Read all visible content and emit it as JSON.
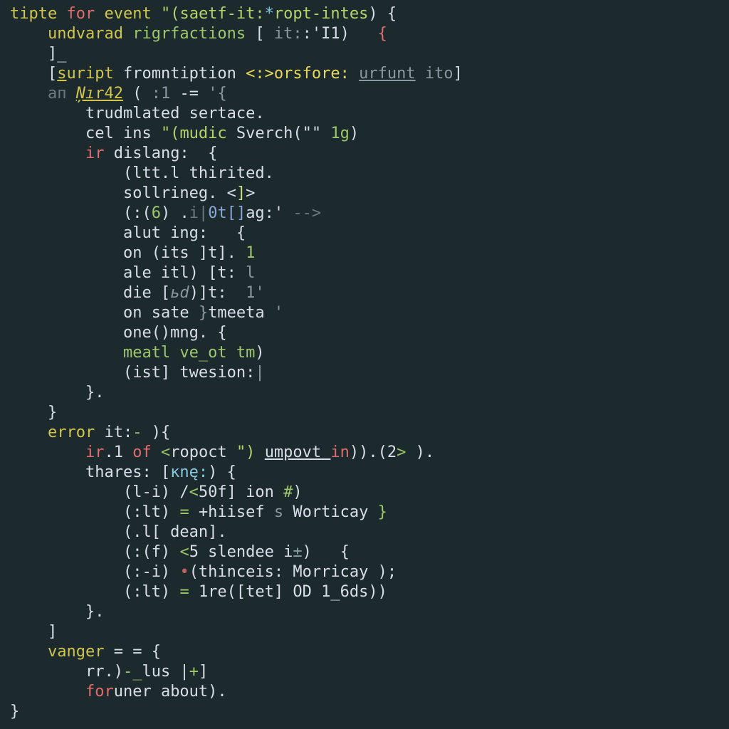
{
  "colors": {
    "background": "#1c2a2e",
    "default": "#d8dee8",
    "yellow": "#d0c54a",
    "yellow_bright": "#e8d85a",
    "string_green": "#b6d26a",
    "green": "#9ec66a",
    "red": "#e06c6c",
    "red_muted": "#c06060",
    "grey": "#8a99a0",
    "grey_dim": "#6e7a80",
    "cyan": "#88c8e0",
    "blue": "#88a8d8",
    "lime": "#c8e082"
  },
  "lines": [
    {
      "indent": 0,
      "tokens": [
        {
          "t": "tipte ",
          "c": "c-yel"
        },
        {
          "t": "for ",
          "c": "c-red"
        },
        {
          "t": "event ",
          "c": "c-yel"
        },
        {
          "t": "\"(",
          "c": "c-str"
        },
        {
          "t": "saetf-іt:",
          "c": "c-str"
        },
        {
          "t": "*",
          "c": "c-cyn"
        },
        {
          "t": "ropt-intes",
          "c": "c-str"
        },
        {
          "t": ") {",
          "c": "c-wht"
        }
      ]
    },
    {
      "indent": 1,
      "tokens": [
        {
          "t": "undvarad ",
          "c": "c-yel"
        },
        {
          "t": "rigrfactions ",
          "c": "c-grn"
        },
        {
          "t": "[ ",
          "c": "c-wht"
        },
        {
          "t": "it:",
          "c": "c-gry"
        },
        {
          "t": ":'I1",
          "c": "c-wht"
        },
        {
          "t": ")",
          "c": "c-wht"
        },
        {
          "t": "   {",
          "c": "c-red"
        }
      ]
    },
    {
      "indent": 1,
      "tokens": [
        {
          "t": "]",
          "c": "c-wht"
        },
        {
          "t": "_",
          "c": "c-wht caret-holder"
        }
      ]
    },
    {
      "indent": 1,
      "tokens": [
        {
          "t": "[",
          "c": "c-wht"
        },
        {
          "t": "s",
          "c": "c-yel u"
        },
        {
          "t": "uript ",
          "c": "c-yel"
        },
        {
          "t": "fromntiption ",
          "c": "c-wht"
        },
        {
          "t": "<:>",
          "c": "c-yelbr"
        },
        {
          "t": "orsfore: ",
          "c": "c-yelbr"
        },
        {
          "t": "urfunt",
          "c": "c-gry u"
        },
        {
          "t": " ito",
          "c": "c-gry"
        },
        {
          "t": "]",
          "c": "c-wht"
        }
      ]
    },
    {
      "indent": 1,
      "tokens": [
        {
          "t": "aп ",
          "c": "c-grydim"
        },
        {
          "t": "Ņı",
          "c": "c-yel i u"
        },
        {
          "t": "r42",
          "c": "c-yel u"
        },
        {
          "t": " ( ",
          "c": "c-wht"
        },
        {
          "t": ":1 ",
          "c": "c-gry"
        },
        {
          "t": "-= ",
          "c": "c-wht"
        },
        {
          "t": "'{",
          "c": "c-gry"
        }
      ]
    },
    {
      "indent": 2,
      "tokens": [
        {
          "t": "trudmlated sertace.",
          "c": "c-wht"
        }
      ]
    },
    {
      "indent": 2,
      "tokens": [
        {
          "t": "cel ins ",
          "c": "c-wht"
        },
        {
          "t": "\"(",
          "c": "c-str"
        },
        {
          "t": "mudic ",
          "c": "c-str"
        },
        {
          "t": "Sverch(\"\" ",
          "c": "c-wht"
        },
        {
          "t": "1g",
          "c": "c-grn"
        },
        {
          "t": ")",
          "c": "c-wht"
        }
      ]
    },
    {
      "indent": 2,
      "tokens": [
        {
          "t": "ir ",
          "c": "c-red"
        },
        {
          "t": "dislang:  {",
          "c": "c-wht"
        }
      ]
    },
    {
      "indent": 3,
      "tokens": [
        {
          "t": "(ltt.l thirited.",
          "c": "c-wht"
        }
      ]
    },
    {
      "indent": 3,
      "tokens": [
        {
          "t": "sollrineg. ",
          "c": "c-wht"
        },
        {
          "t": "<",
          "c": "c-wht"
        },
        {
          "t": "]",
          "c": "c-lux"
        },
        {
          "t": ">",
          "c": "c-wht"
        }
      ]
    },
    {
      "indent": 3,
      "tokens": [
        {
          "t": "(:(",
          "c": "c-wht"
        },
        {
          "t": "6",
          "c": "c-grn"
        },
        {
          "t": ") .",
          "c": "c-wht"
        },
        {
          "t": "i|",
          "c": "c-grydim"
        },
        {
          "t": "0t[]",
          "c": "c-blu"
        },
        {
          "t": "ag:' ",
          "c": "c-wht"
        },
        {
          "t": "-->",
          "c": "c-grydim"
        }
      ]
    },
    {
      "indent": 3,
      "tokens": [
        {
          "t": "alut ing:   {",
          "c": "c-wht"
        }
      ]
    },
    {
      "indent": 3,
      "tokens": [
        {
          "t": "on (its ]t]. ",
          "c": "c-wht"
        },
        {
          "t": "1",
          "c": "c-grn"
        }
      ]
    },
    {
      "indent": 3,
      "tokens": [
        {
          "t": "ale itl) [t: ",
          "c": "c-wht"
        },
        {
          "t": "l",
          "c": "c-gry"
        }
      ]
    },
    {
      "indent": 3,
      "tokens": [
        {
          "t": "die [",
          "c": "c-wht"
        },
        {
          "t": "ьd",
          "c": "c-gry i"
        },
        {
          "t": ")]t:  ",
          "c": "c-wht"
        },
        {
          "t": "1'",
          "c": "c-gry"
        }
      ]
    },
    {
      "indent": 3,
      "tokens": [
        {
          "t": "on",
          "c": "c-wht"
        },
        {
          "t": " sate ",
          "c": "c-wht"
        },
        {
          "t": "}",
          "c": "c-gry"
        },
        {
          "t": "tmeeta ",
          "c": "c-wht"
        },
        {
          "t": "'",
          "c": "c-gry"
        }
      ]
    },
    {
      "indent": 3,
      "tokens": [
        {
          "t": "one()mng. {",
          "c": "c-wht"
        }
      ]
    },
    {
      "indent": 3,
      "tokens": [
        {
          "t": "meatl ve_ot tm",
          "c": "c-grn"
        },
        {
          "t": ")",
          "c": "c-wht"
        }
      ]
    },
    {
      "indent": 3,
      "tokens": [
        {
          "t": "(ist] twesion:",
          "c": "c-wht"
        },
        {
          "t": "|",
          "c": "c-gry"
        }
      ]
    },
    {
      "indent": 2,
      "tokens": [
        {
          "t": "}.",
          "c": "c-wht"
        }
      ]
    },
    {
      "indent": 1,
      "tokens": [
        {
          "t": "}",
          "c": "c-wht"
        }
      ]
    },
    {
      "indent": 1,
      "tokens": [
        {
          "t": "error ",
          "c": "c-yel"
        },
        {
          "t": "it:",
          "c": "c-wht"
        },
        {
          "t": "- ",
          "c": "c-grn"
        },
        {
          "t": "){",
          "c": "c-wht"
        }
      ]
    },
    {
      "indent": 2,
      "tokens": [
        {
          "t": "ir",
          "c": "c-red"
        },
        {
          "t": ".1 ",
          "c": "c-wht"
        },
        {
          "t": "of ",
          "c": "c-red"
        },
        {
          "t": "<",
          "c": "c-grn"
        },
        {
          "t": "ropoct ",
          "c": "c-wht"
        },
        {
          "t": "\") ",
          "c": "c-str"
        },
        {
          "t": "umpovt ",
          "c": "c-wht u"
        },
        {
          "t": "in",
          "c": "c-red"
        },
        {
          "t": ")).",
          "c": "c-wht"
        },
        {
          "t": "(2",
          "c": "c-wht"
        },
        {
          "t": ">",
          "c": "c-grn"
        },
        {
          "t": " ).",
          "c": "c-wht"
        }
      ]
    },
    {
      "indent": 2,
      "tokens": [
        {
          "t": "thares: ",
          "c": "c-wht"
        },
        {
          "t": "[",
          "c": "c-wht"
        },
        {
          "t": "кnę:",
          "c": "c-cyn"
        },
        {
          "t": ") {",
          "c": "c-wht"
        }
      ]
    },
    {
      "indent": 3,
      "tokens": [
        {
          "t": "(l-i) /",
          "c": "c-wht"
        },
        {
          "t": "<",
          "c": "c-grn"
        },
        {
          "t": "50f] ion ",
          "c": "c-wht"
        },
        {
          "t": "#",
          "c": "c-grn"
        },
        {
          "t": ")",
          "c": "c-wht"
        }
      ]
    },
    {
      "indent": 3,
      "tokens": [
        {
          "t": "(:lt) ",
          "c": "c-wht"
        },
        {
          "t": "= ",
          "c": "c-grn"
        },
        {
          "t": "+hiisef ",
          "c": "c-wht"
        },
        {
          "t": "ѕ",
          "c": "c-gry"
        },
        {
          "t": " Worticay ",
          "c": "c-wht"
        },
        {
          "t": "}",
          "c": "c-grn"
        }
      ]
    },
    {
      "indent": 3,
      "tokens": [
        {
          "t": "(.l[ dean].",
          "c": "c-wht"
        }
      ]
    },
    {
      "indent": 3,
      "tokens": [
        {
          "t": "(:(f) ",
          "c": "c-wht"
        },
        {
          "t": "<",
          "c": "c-grn"
        },
        {
          "t": "5 slendee i",
          "c": "c-wht"
        },
        {
          "t": "±",
          "c": "c-gry"
        },
        {
          "t": ")   {",
          "c": "c-wht"
        }
      ]
    },
    {
      "indent": 3,
      "tokens": [
        {
          "t": "(:-i) ",
          "c": "c-wht"
        },
        {
          "t": "•",
          "c": "c-redm"
        },
        {
          "t": "(thinceis: Morricay );",
          "c": "c-wht"
        }
      ]
    },
    {
      "indent": 3,
      "tokens": [
        {
          "t": "(:lt) ",
          "c": "c-wht"
        },
        {
          "t": "= ",
          "c": "c-grn"
        },
        {
          "t": "1re([tet] OD 1_6ds))",
          "c": "c-wht"
        }
      ]
    },
    {
      "indent": 2,
      "tokens": [
        {
          "t": "}.",
          "c": "c-wht"
        }
      ]
    },
    {
      "indent": 1,
      "tokens": [
        {
          "t": "]",
          "c": "c-wht"
        }
      ]
    },
    {
      "indent": 1,
      "tokens": [
        {
          "t": "vanger ",
          "c": "c-yel"
        },
        {
          "t": "= = ",
          "c": "c-wht"
        },
        {
          "t": "{",
          "c": "c-wht"
        }
      ]
    },
    {
      "indent": 2,
      "tokens": [
        {
          "t": "rr.)",
          "c": "c-wht"
        },
        {
          "t": "-_",
          "c": "c-grn"
        },
        {
          "t": "lus |",
          "c": "c-wht"
        },
        {
          "t": "+",
          "c": "c-grn"
        },
        {
          "t": "]",
          "c": "c-wht"
        }
      ]
    },
    {
      "indent": 2,
      "tokens": [
        {
          "t": "for",
          "c": "c-red"
        },
        {
          "t": "uner about).",
          "c": "c-wht"
        }
      ]
    },
    {
      "indent": 0,
      "tokens": [
        {
          "t": "}",
          "c": "c-wht"
        }
      ]
    }
  ]
}
